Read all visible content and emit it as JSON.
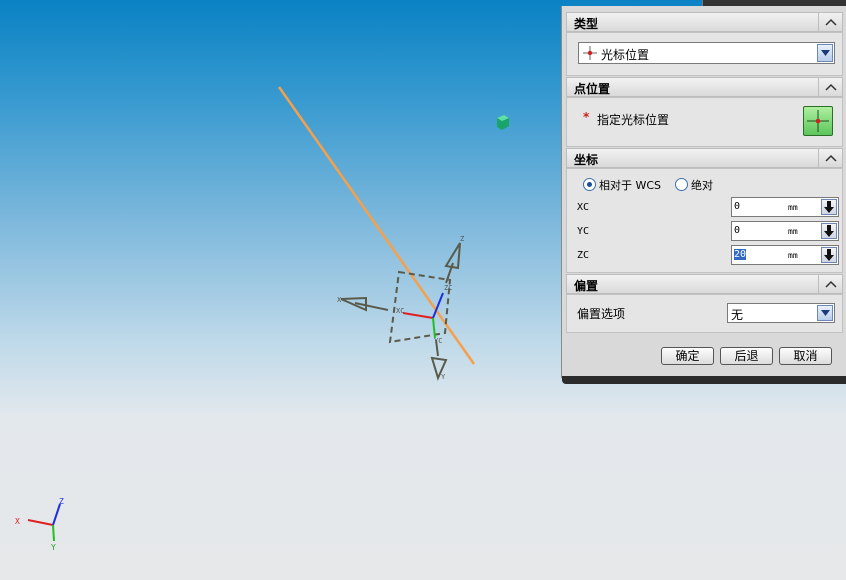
{
  "viewport": {
    "triad_labels": {
      "x": "X",
      "y": "Y",
      "z": "Z"
    },
    "csys_labels": {
      "x": "X",
      "y": "Y",
      "z": "Z",
      "xc": "XC",
      "yc": "YC",
      "zc": "ZC"
    }
  },
  "dialog": {
    "type_section": {
      "title": "类型",
      "selected": "光标位置"
    },
    "point_section": {
      "title": "点位置",
      "prompt_marker": "*",
      "prompt": "指定光标位置"
    },
    "coord_section": {
      "title": "坐标",
      "radio_relative": "相对于 WCS",
      "radio_absolute": "绝对",
      "fields": [
        {
          "label": "XC",
          "value": "0",
          "unit": "mm"
        },
        {
          "label": "YC",
          "value": "0",
          "unit": "mm"
        },
        {
          "label": "ZC",
          "value": "20",
          "unit": "mm"
        }
      ]
    },
    "offset_section": {
      "title": "偏置",
      "option_label": "偏置选项",
      "option_value": "无"
    },
    "buttons": {
      "ok": "确定",
      "back": "后退",
      "cancel": "取消"
    }
  },
  "colors": {
    "accent": "#316ac5",
    "line": "#f5a04a",
    "point": "#1aa36a"
  }
}
